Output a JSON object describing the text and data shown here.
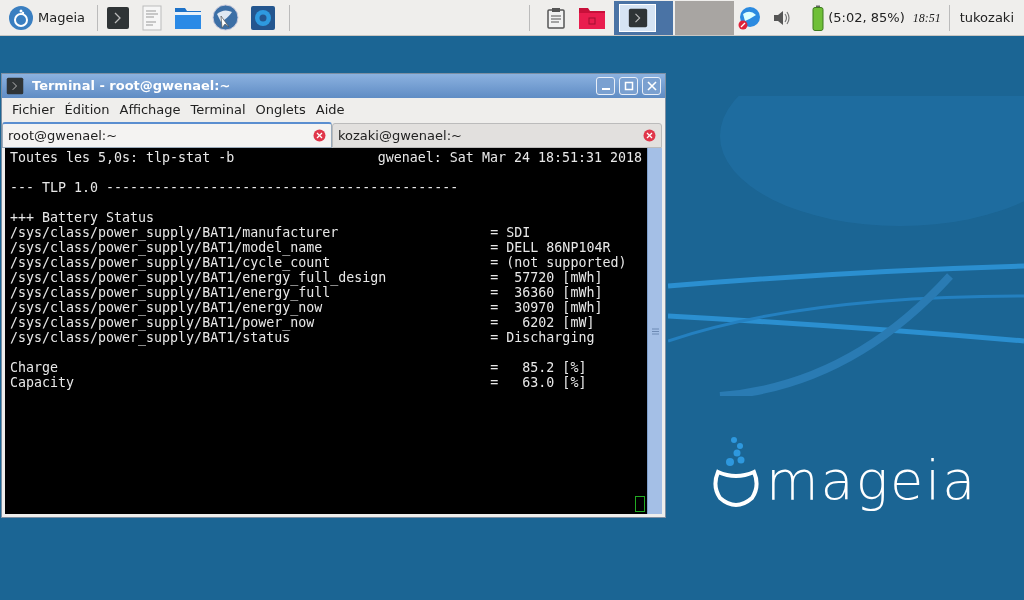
{
  "panel": {
    "menu_label": "Mageia",
    "tasks": [
      {
        "selected": true
      },
      {
        "selected": false
      }
    ],
    "battery_text": "(5:02, 85%)",
    "clock": "18:51",
    "user": "tukozaki"
  },
  "window": {
    "title": "Terminal - root@gwenael:~",
    "menu": [
      "Fichier",
      "Édition",
      "Affichage",
      "Terminal",
      "Onglets",
      "Aide"
    ],
    "tabs": [
      {
        "label": "root@gwenael:~",
        "selected": true
      },
      {
        "label": "kozaki@gwenael:~",
        "selected": false
      }
    ],
    "terminal": {
      "header_left": "Toutes les 5,0s: tlp-stat -b",
      "header_right": "gwenael: Sat Mar 24 18:51:31 2018",
      "sections": [
        [
          "--- TLP 1.0 --------------------------------------------"
        ],
        [
          "+++ Battery Status",
          "/sys/class/power_supply/BAT1/manufacturer                   = SDI",
          "/sys/class/power_supply/BAT1/model_name                     = DELL 86NP104R",
          "/sys/class/power_supply/BAT1/cycle_count                    = (not supported)",
          "/sys/class/power_supply/BAT1/energy_full_design             =  57720 [mWh]",
          "/sys/class/power_supply/BAT1/energy_full                    =  36360 [mWh]",
          "/sys/class/power_supply/BAT1/energy_now                     =  30970 [mWh]",
          "/sys/class/power_supply/BAT1/power_now                      =   6202 [mW]",
          "/sys/class/power_supply/BAT1/status                         = Discharging"
        ],
        [
          "Charge                                                      =   85.2 [%]",
          "Capacity                                                    =   63.0 [%]"
        ]
      ]
    }
  },
  "wallpaper": {
    "logo_text": "mageia"
  }
}
